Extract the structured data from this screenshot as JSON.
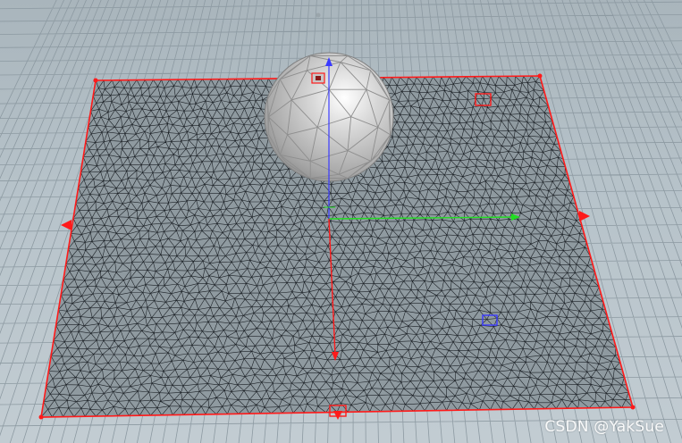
{
  "viewport": {
    "name": "3d-viewport",
    "background_color": "#b7c3ca",
    "grid_color": "#8d9aa2",
    "objects": [
      {
        "name": "ground-grid",
        "type": "reference grid"
      },
      {
        "name": "cloth-plane",
        "type": "triangulated grid mesh",
        "wire_color": "#1a1f24",
        "border_color": "#ff1a1a",
        "fill_color": "#8f9aa0"
      },
      {
        "name": "sphere",
        "type": "geodesic sphere",
        "surface_color": "#c9c9c9",
        "edge_color": "#8e8e8e"
      }
    ],
    "handle_color": "#ff1a1a",
    "gizmo": {
      "x_color": "#ff1a1a",
      "y_color": "#3a3aff",
      "z_color": "#22dd22"
    }
  },
  "watermark": {
    "text": "CSDN @YakSue"
  }
}
